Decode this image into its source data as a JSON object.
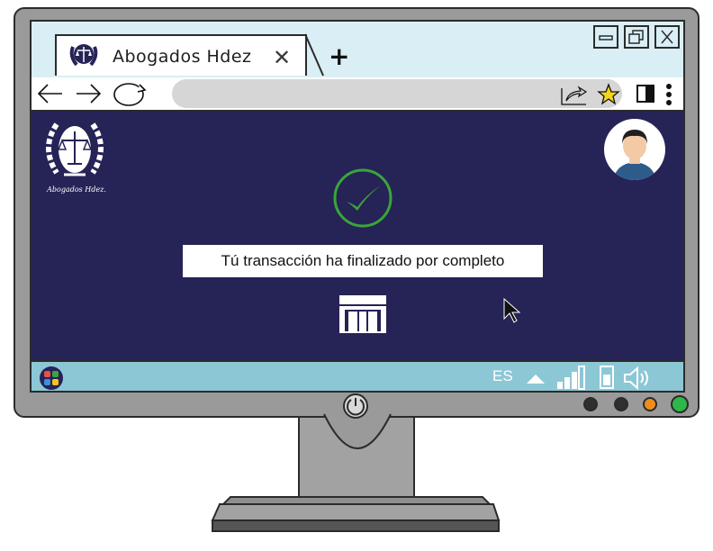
{
  "browser": {
    "tab": {
      "title": "Abogados  Hdez",
      "close_glyph": "✕"
    },
    "new_tab_glyph": "+",
    "window_controls": [
      "minimize-icon",
      "restore-icon",
      "close-icon"
    ]
  },
  "page": {
    "logo_caption": "Abogados Hdez.",
    "message": "Tú transacción ha finalizado por completo",
    "success_icon": "check-circle-icon",
    "bank_icon": "bank-icon",
    "avatar_icon": "user-avatar-icon"
  },
  "taskbar": {
    "language": "ES",
    "icons": [
      "start-icon",
      "tray-up-icon",
      "signal-icon",
      "battery-icon",
      "volume-icon"
    ]
  },
  "colors": {
    "page_bg": "#262357",
    "success_green": "#3aa53a",
    "titlebar": "#d9eef5",
    "taskbar": "#8cc7d6",
    "bezel": "#9a9a9a"
  },
  "monitor": {
    "power_button": "power-icon",
    "status_lights": [
      "#2f2f2f",
      "#2f2f2f",
      "#f08c1e",
      "#2fb84a"
    ]
  }
}
